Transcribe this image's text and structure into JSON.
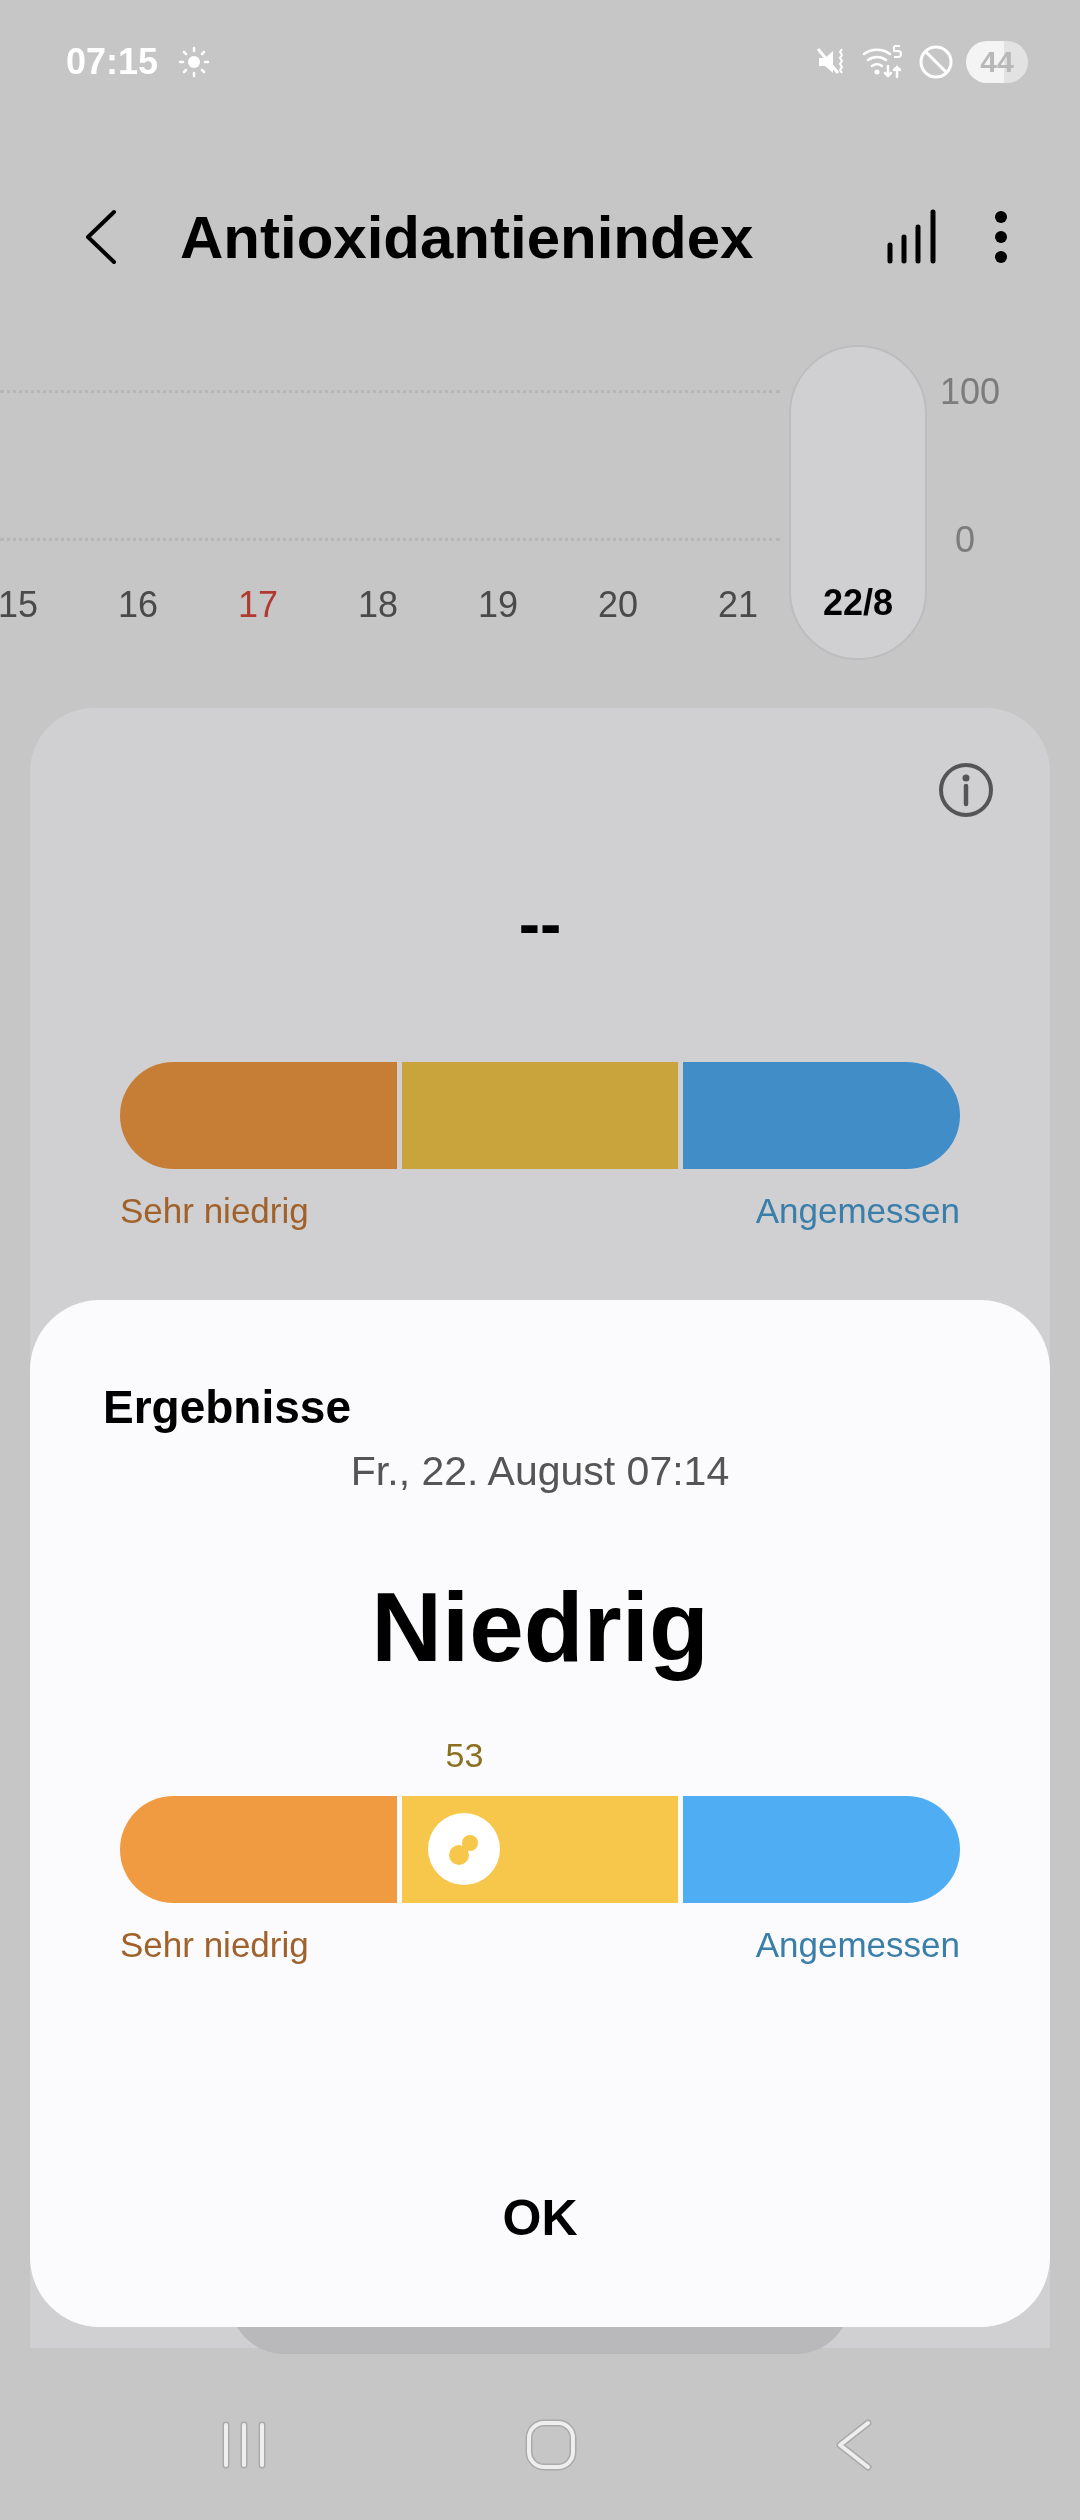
{
  "status_bar": {
    "time": "07:15",
    "battery": "44"
  },
  "header": {
    "title": "Antioxidantienindex"
  },
  "date_strip": {
    "y_labels": [
      "100",
      "0"
    ],
    "days": [
      {
        "label": "15",
        "sunday": false,
        "selected": false
      },
      {
        "label": "16",
        "sunday": false,
        "selected": false
      },
      {
        "label": "17",
        "sunday": true,
        "selected": false
      },
      {
        "label": "18",
        "sunday": false,
        "selected": false
      },
      {
        "label": "19",
        "sunday": false,
        "selected": false
      },
      {
        "label": "20",
        "sunday": false,
        "selected": false
      },
      {
        "label": "21",
        "sunday": false,
        "selected": false
      },
      {
        "label": "22/8",
        "sunday": false,
        "selected": true
      }
    ]
  },
  "index_card": {
    "value": "--",
    "gauge": {
      "segments": [
        {
          "color": "#c67d35"
        },
        {
          "color": "#c9a43c"
        },
        {
          "color": "#418dc8"
        }
      ],
      "label_low": "Sehr niedrig",
      "label_high": "Angemessen"
    }
  },
  "dialog": {
    "title": "Ergebnisse",
    "date": "Fr., 22. August 07:14",
    "result": "Niedrig",
    "gauge": {
      "reading": "53",
      "segments": [
        {
          "color": "#f09b42"
        },
        {
          "color": "#f6c74a"
        },
        {
          "color": "#4fadf3"
        }
      ],
      "label_low": "Sehr niedrig",
      "label_high": "Angemessen"
    },
    "button": "OK"
  }
}
